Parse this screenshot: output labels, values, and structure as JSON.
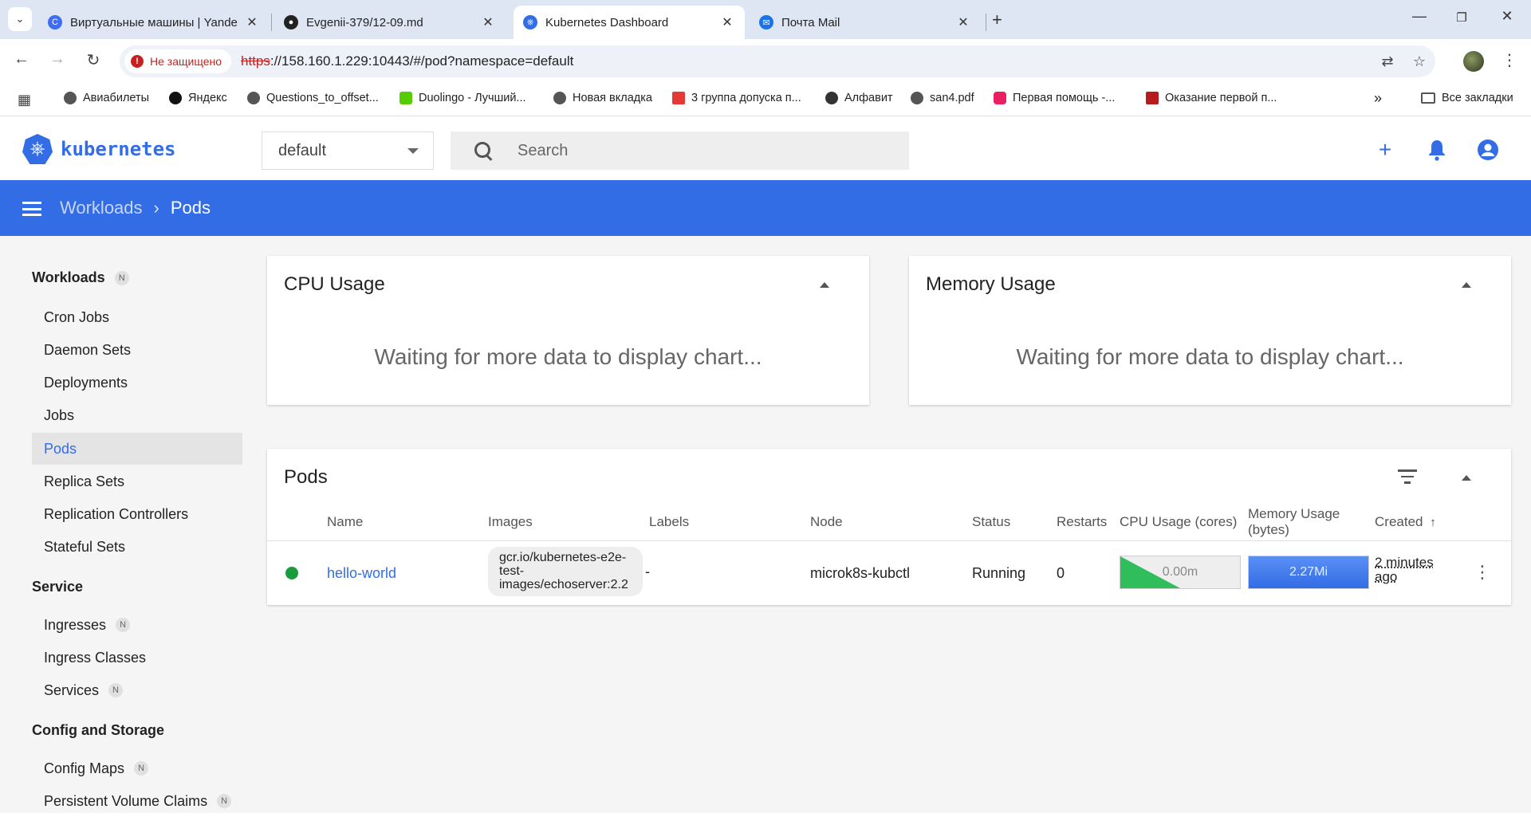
{
  "browser": {
    "tabs": [
      {
        "title": "Виртуальные машины | Yandex",
        "icon": "yandex-cloud-icon",
        "color": "#3d6df2"
      },
      {
        "title": "Evgenii-379/12-09.md",
        "icon": "github-icon",
        "color": "#222222"
      },
      {
        "title": "Kubernetes Dashboard",
        "icon": "kubernetes-icon",
        "color": "#326de6"
      },
      {
        "title": "Почта Mail",
        "icon": "mail-icon",
        "color": "#1a73e8"
      }
    ],
    "security_label": "Не защищено",
    "url_scheme": "https",
    "url_rest": "://158.160.1.229:10443/#/pod?namespace=default",
    "bookmarks": [
      "Авиабилеты",
      "Яндекс",
      "Questions_to_offset...",
      "Duolingo - Лучший...",
      "Новая вкладка",
      "3 группа допуска п...",
      "Алфавит",
      "san4.pdf",
      "Первая помощь -...",
      "Оказание первой п..."
    ],
    "all_bookmarks": "Все закладки"
  },
  "header": {
    "logo": "kubernetes",
    "namespace": "default",
    "search_placeholder": "Search"
  },
  "breadcrumb": {
    "parent": "Workloads",
    "current": "Pods"
  },
  "sidebar": {
    "workloads_label": "Workloads",
    "workloads_badge": "N",
    "workload_items": [
      "Cron Jobs",
      "Daemon Sets",
      "Deployments",
      "Jobs",
      "Pods",
      "Replica Sets",
      "Replication Controllers",
      "Stateful Sets"
    ],
    "service_label": "Service",
    "service_items": [
      {
        "label": "Ingresses",
        "badge": "N"
      },
      {
        "label": "Ingress Classes",
        "badge": ""
      },
      {
        "label": "Services",
        "badge": "N"
      }
    ],
    "config_label": "Config and Storage",
    "config_items": [
      {
        "label": "Config Maps",
        "badge": "N"
      },
      {
        "label": "Persistent Volume Claims",
        "badge": "N"
      }
    ]
  },
  "cpu_card": {
    "title": "CPU Usage",
    "message": "Waiting for more data to display chart..."
  },
  "memory_card": {
    "title": "Memory Usage",
    "message": "Waiting for more data to display chart..."
  },
  "pods": {
    "title": "Pods",
    "columns": [
      "Name",
      "Images",
      "Labels",
      "Node",
      "Status",
      "Restarts",
      "CPU Usage (cores)",
      "Memory Usage (bytes)",
      "Created"
    ],
    "memory_col_line1": "Memory Usage",
    "memory_col_line2": "(bytes)",
    "rows": [
      {
        "name": "hello-world",
        "image": "gcr.io/kubernetes-e2e-test-images/echoserver:2.2",
        "labels": "-",
        "node": "microk8s-kubctl",
        "status": "Running",
        "restarts": "0",
        "cpu": "0.00m",
        "memory": "2.27Mi",
        "created_line1": "2 minutes",
        "created_line2": "ago"
      }
    ]
  },
  "colors": {
    "brand": "#326de6",
    "running": "#1a9c3e",
    "cpu_spark": "#2fbe5b"
  }
}
